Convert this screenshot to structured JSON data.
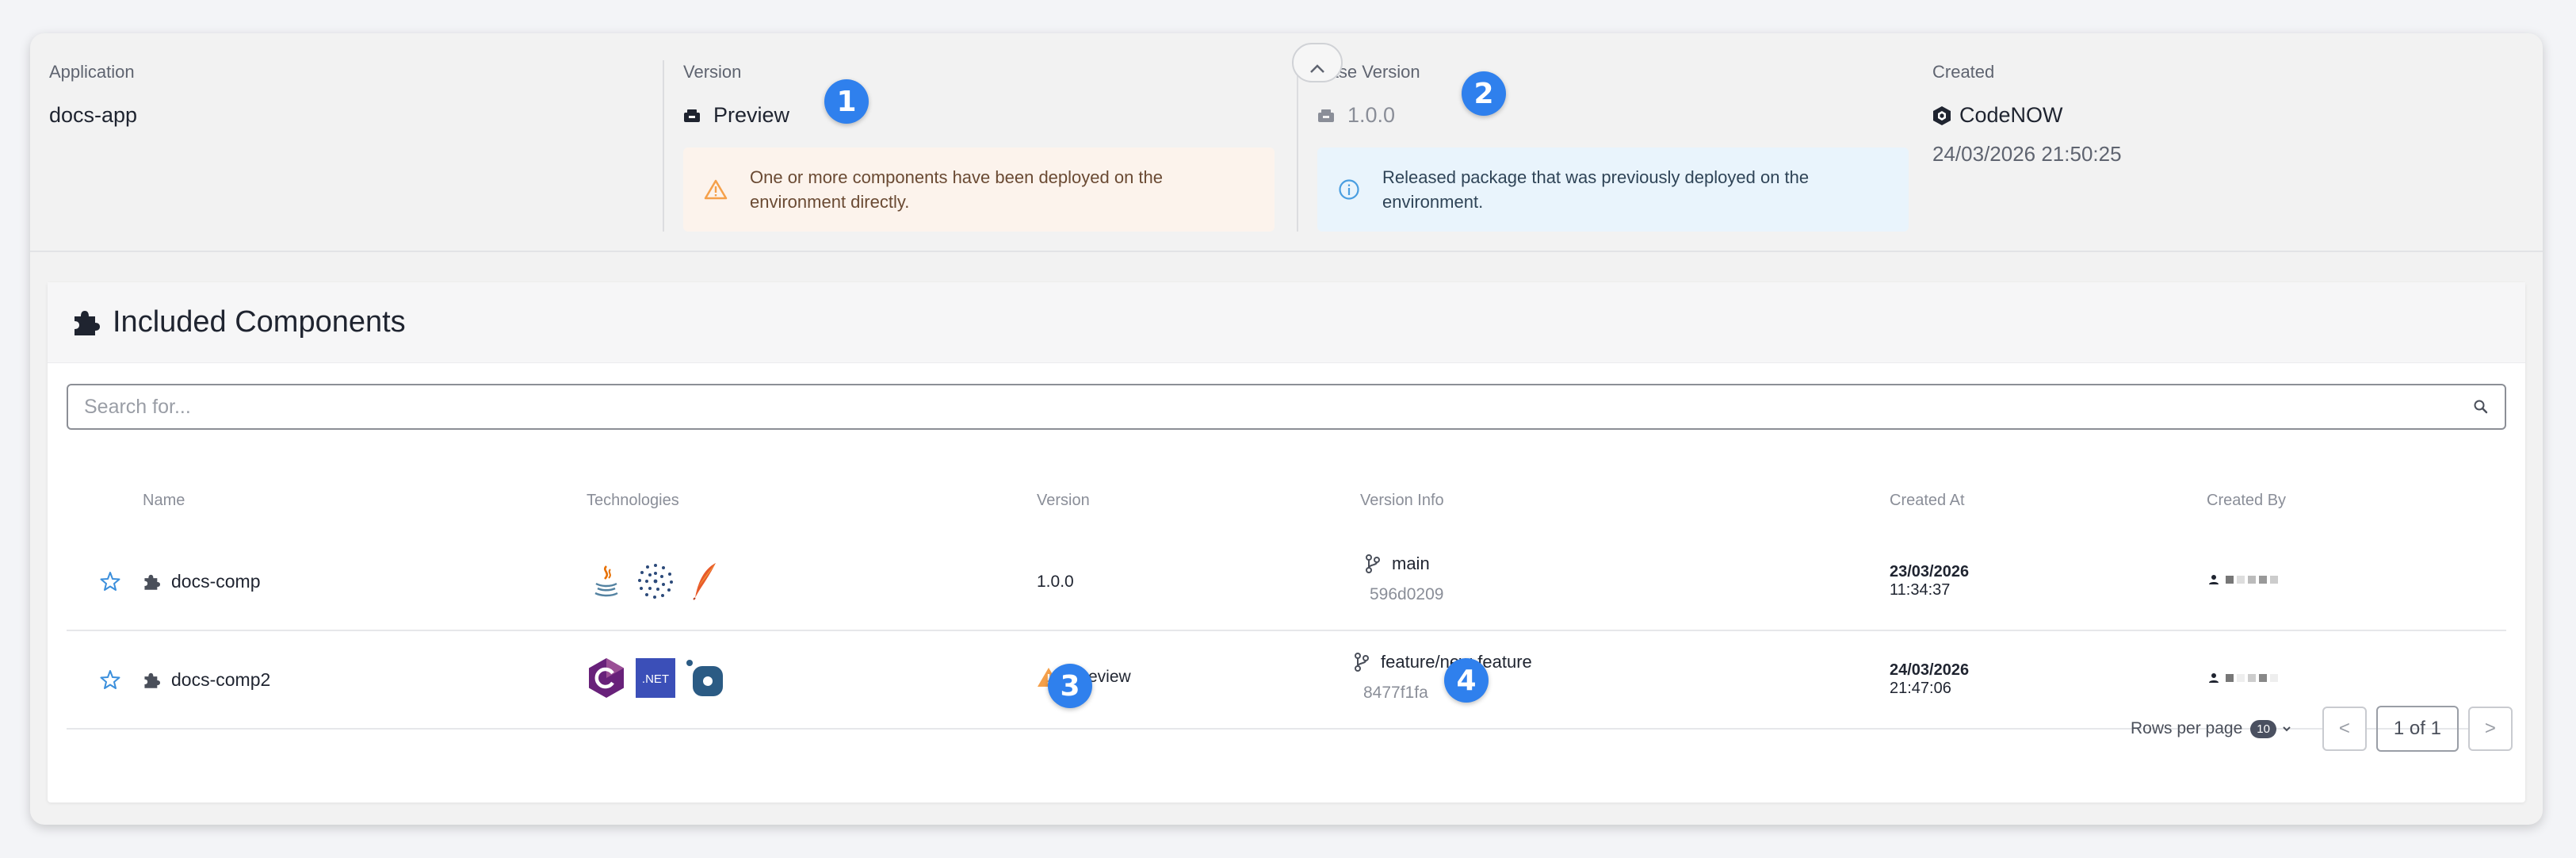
{
  "summary": {
    "application": {
      "label": "Application",
      "value": "docs-app"
    },
    "version": {
      "label": "Version",
      "value": "Preview",
      "alert": "One or more components have been deployed on the environment directly."
    },
    "base_version": {
      "label": "Base Version",
      "value": "1.0.0",
      "alert": "Released package that was previously deployed on the environment."
    },
    "created": {
      "label": "Created",
      "value": "CodeNOW",
      "timestamp": "24/03/2026 21:50:25"
    }
  },
  "badges": [
    "1",
    "2",
    "3",
    "4"
  ],
  "components": {
    "title": "Included Components",
    "search_placeholder": "Search for...",
    "columns": [
      "Name",
      "Technologies",
      "Version",
      "Version Info",
      "Created At",
      "Created By"
    ],
    "rows": [
      {
        "name": "docs-comp",
        "technologies": [
          "java-icon",
          "dotted-sphere-icon",
          "maven-feather-icon"
        ],
        "version": "1.0.0",
        "branch": "main",
        "commit": "596d0209",
        "date": "23/03/2026",
        "time": "11:34:37"
      },
      {
        "name": "docs-comp2",
        "technologies": [
          "csharp-icon",
          "dotnet-icon",
          "python-icon"
        ],
        "version": "Preview",
        "branch": "feature/new-feature",
        "commit": "8477f1fa",
        "date": "24/03/2026",
        "time": "21:47:06"
      }
    ],
    "pagination": {
      "rows_per_page_label": "Rows per page",
      "rows_per_page": "10",
      "prev": "<",
      "current": "1 of 1",
      "next": ">"
    }
  },
  "colors": {
    "badge": "#2f80ed",
    "warning": "#f5a04a",
    "info": "#4a9ee0",
    "star": "#3b8fdc"
  }
}
